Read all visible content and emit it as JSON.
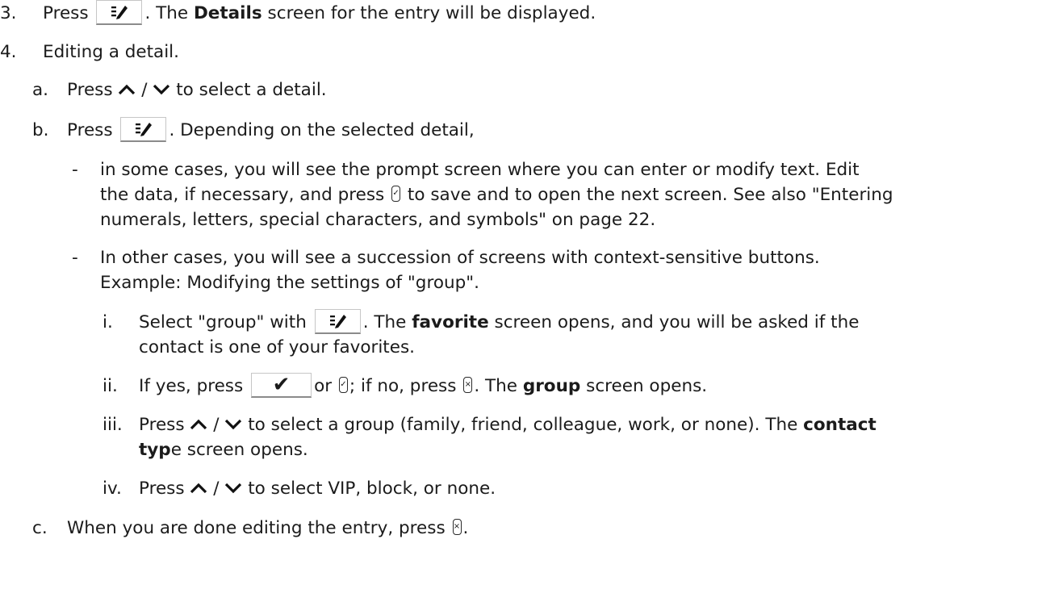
{
  "steps": [
    {
      "marker": "3.",
      "parts": [
        "Press",
        ". The",
        "Details",
        "screen for the entry will be displayed."
      ]
    },
    {
      "marker": "4.",
      "text": "Editing a detail."
    }
  ],
  "substeps": {
    "a": {
      "marker": "a.",
      "parts": [
        "Press",
        "/",
        "to select a detail."
      ]
    },
    "b": {
      "marker": "b.",
      "parts": [
        "Press",
        ". Depending on the selected detail,"
      ]
    },
    "c": {
      "marker": "c.",
      "parts": [
        "When you are done editing the entry, press",
        "."
      ]
    }
  },
  "bullets": [
    {
      "marker": "-",
      "lines": [
        "in some cases, you will see the prompt screen where you can enter or modify text. Edit",
        [
          "the data, if necessary, and press",
          "to save and to open the next screen. See also \"Entering"
        ],
        "numerals, letters, special characters, and symbols\" on page 22."
      ]
    },
    {
      "marker": "-",
      "lines": [
        "In other cases, you will see a succession of screens with context-sensitive buttons.",
        "Example: Modifying the settings of \"group\"."
      ]
    }
  ],
  "roman": {
    "i": {
      "marker": "i.",
      "line1": [
        "Select \"group\" with",
        ". The",
        "favorite",
        "screen opens, and you will be asked if the"
      ],
      "line2": "contact is one of your favorites."
    },
    "ii": {
      "marker": "ii.",
      "parts": [
        "If yes, press",
        "or",
        "; if no, press",
        ". The",
        "group",
        "screen opens."
      ]
    },
    "iii": {
      "marker": "iii.",
      "line1": [
        "Press",
        "/",
        "to select a group (family, friend, colleague, work, or none). The",
        "contact"
      ],
      "line2": [
        "typ",
        "e screen opens."
      ]
    },
    "iv": {
      "marker": "iv.",
      "parts": [
        "Press",
        "/",
        "to select VIP, block, or none."
      ]
    }
  },
  "icons": {
    "ok_key": "✓",
    "cancel_key": "×",
    "check_glyph": "✔"
  }
}
